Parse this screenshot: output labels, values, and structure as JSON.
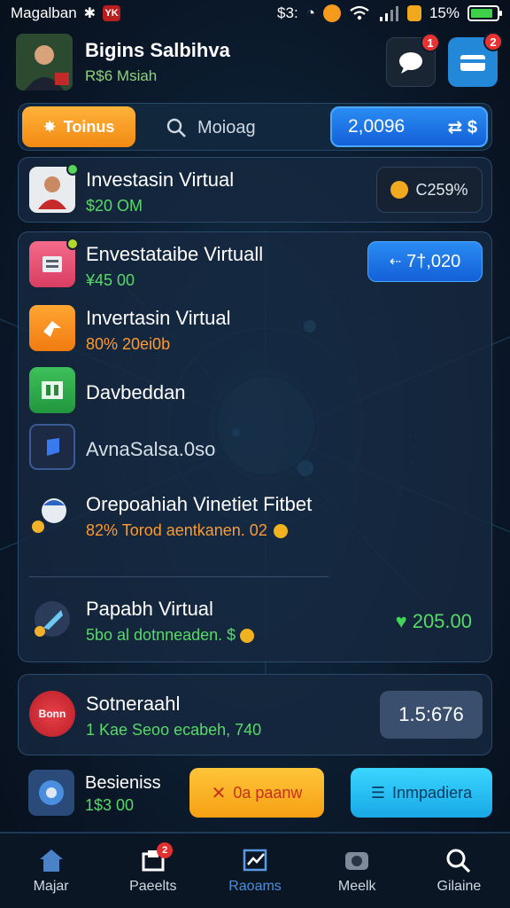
{
  "status_bar": {
    "carrier": "Magalban",
    "time": "$3:",
    "battery_percent": "15%",
    "battery_level": 0.85
  },
  "header": {
    "title": "Bigins Salbihva",
    "subtitle": "R$6 Msiah",
    "notification_badge": "1",
    "wallet_badge": "2"
  },
  "toolbar": {
    "left_button": "Toinus",
    "search_label": "Moioag",
    "balance": "2,0096",
    "balance_extra": "$"
  },
  "featured": {
    "title": "Investasin Virtual",
    "amount": "$20 OM",
    "rate": "C259%"
  },
  "list": {
    "items": [
      {
        "title": "Envestataibe Virtuall",
        "sub": "¥45 00",
        "action": "7†,020"
      },
      {
        "title": "Invertasin Virtual",
        "sub": "80% 20ei0b"
      },
      {
        "title": "Davbeddan"
      },
      {
        "title": "AvnaSalsa.0so"
      },
      {
        "title": "Orepoahiah Vinetiet Fitbet",
        "sub": "82% Torod aentkanen. 02"
      },
      {
        "title": "Papabh Virtual",
        "sub": "5bo al dotnneaden. $",
        "amount": "205.00"
      }
    ]
  },
  "sotner": {
    "title": "Sotneraahl",
    "sub": "1 Kae Seoo ecabeh, 740",
    "value": "1.5:676",
    "icon_text": "Bonn"
  },
  "business": {
    "title": "Besieniss",
    "amount": "1$3 00",
    "btn_orange": "0a paanw",
    "btn_cyan": "Inmpadiera"
  },
  "nav": {
    "items": [
      {
        "label": "Majar",
        "icon": "home-icon"
      },
      {
        "label": "Paeelts",
        "icon": "layers-icon",
        "badge": "2"
      },
      {
        "label": "Raoams",
        "icon": "chart-icon"
      },
      {
        "label": "Meelk",
        "icon": "camera-icon"
      },
      {
        "label": "Gilaine",
        "icon": "search-icon"
      }
    ]
  },
  "colors": {
    "accent_orange": "#f5a012",
    "accent_blue": "#1e7ae8",
    "accent_cyan": "#2cc4f2",
    "positive_green": "#58d968"
  }
}
